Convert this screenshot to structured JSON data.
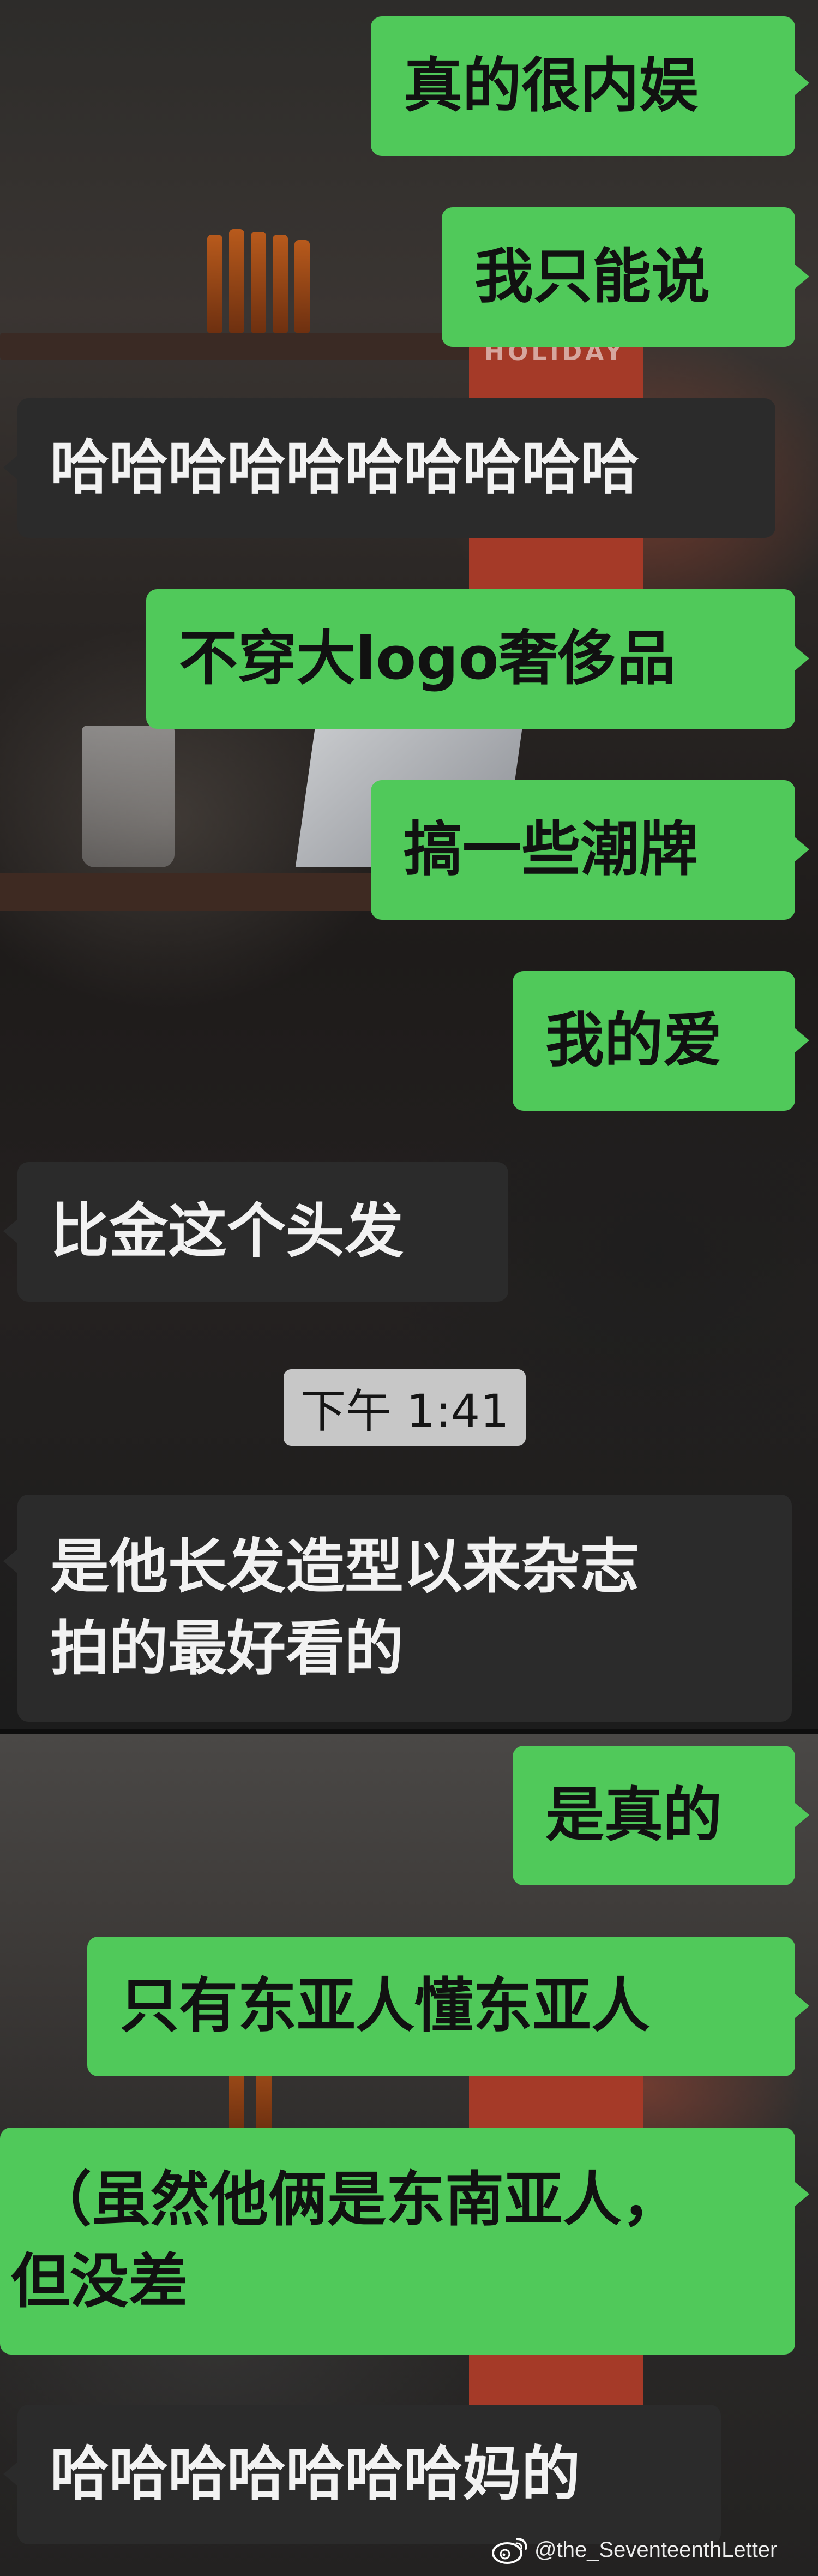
{
  "messages": [
    {
      "text": "真的很内娱",
      "from": "me"
    },
    {
      "text": "我只能说",
      "from": "me"
    },
    {
      "text": "哈哈哈哈哈哈哈哈哈哈",
      "from": "other"
    },
    {
      "text": "不穿大logo奢侈品",
      "from": "me"
    },
    {
      "text": "搞一些潮牌",
      "from": "me"
    },
    {
      "text": "我的爱",
      "from": "me"
    },
    {
      "text": "比金这个头发",
      "from": "other"
    },
    {
      "text_line1": "是他长发造型以来杂志",
      "text_line2": "拍的最好看的",
      "from": "other"
    },
    {
      "text": "是真的",
      "from": "me"
    },
    {
      "text": "只有东亚人懂东亚人",
      "from": "me"
    },
    {
      "text_line1": "（虽然他俩是东南亚人，",
      "text_line2": "但没差",
      "from": "me"
    },
    {
      "text": "哈哈哈哈哈哈哈妈的",
      "from": "other"
    }
  ],
  "timestamp": "下午 1:41",
  "watermark": "@the_SeventeenthLetter",
  "background_sign": "HOLIDAY",
  "colors": {
    "outgoing_bubble": "#50c95a",
    "incoming_bubble": "#2b2b2b",
    "timestamp_bg": "#d6d6d6"
  }
}
